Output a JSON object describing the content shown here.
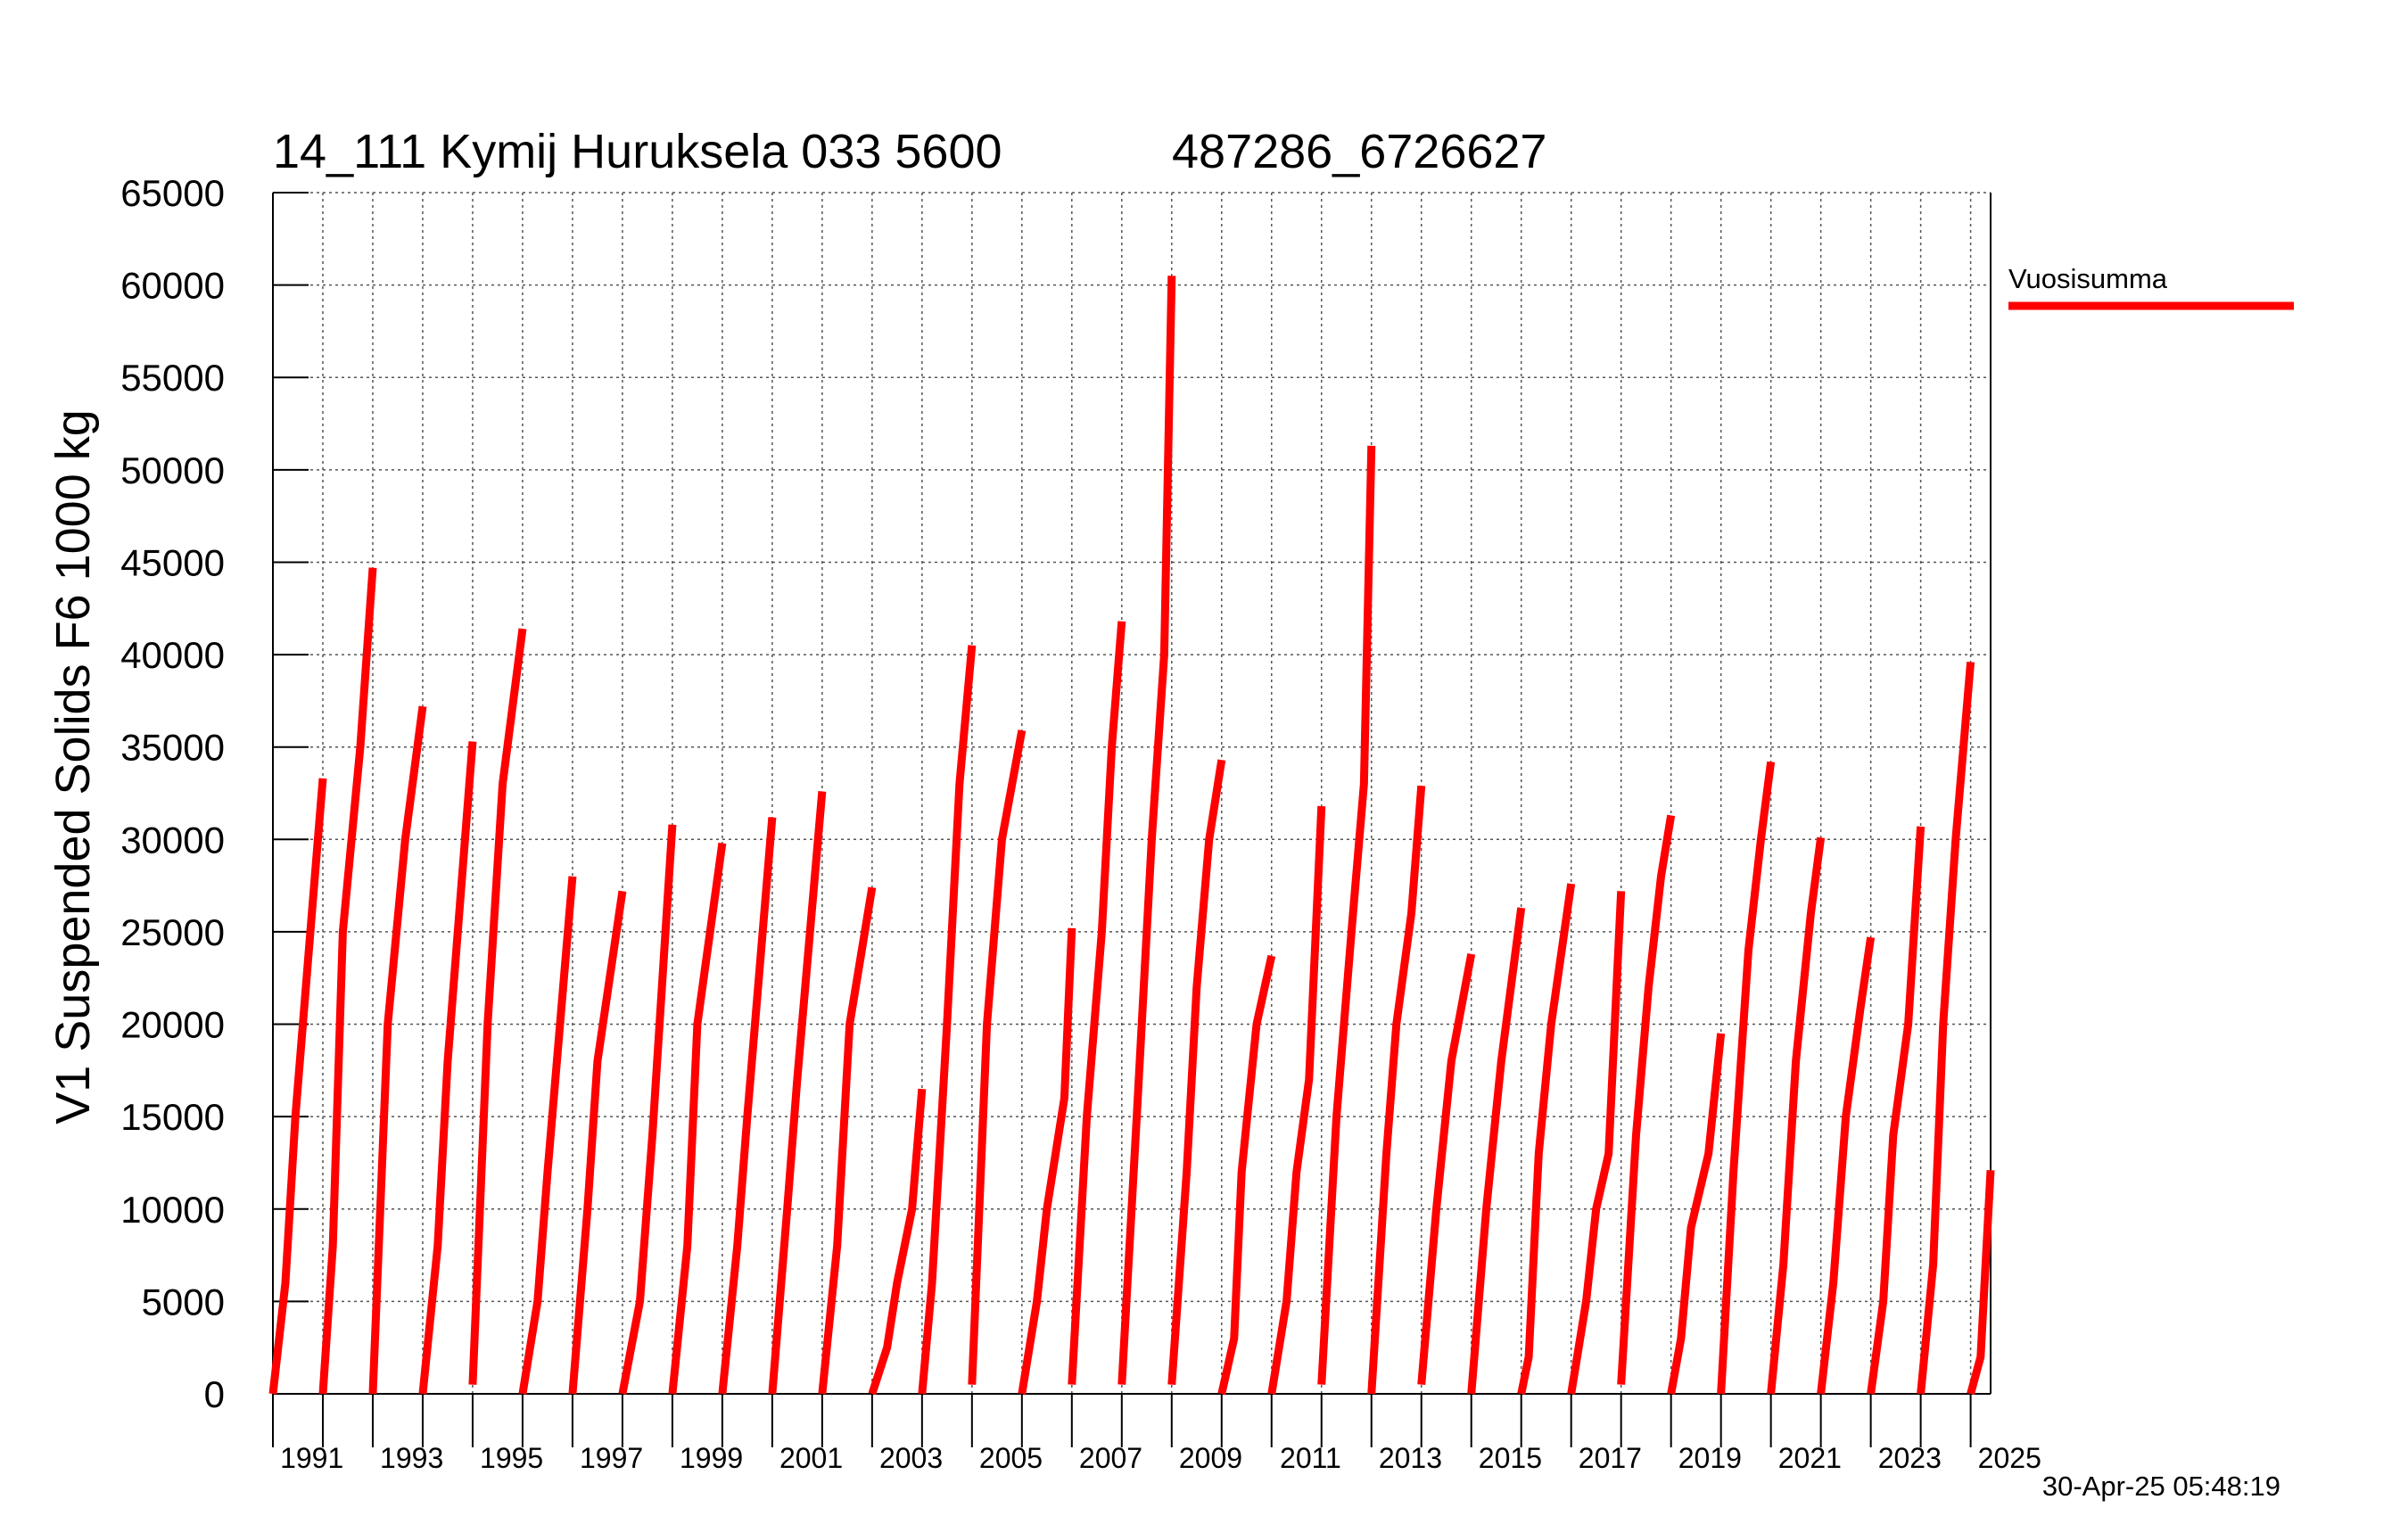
{
  "colors": {
    "series": "#ff0000",
    "grid": "#555555",
    "axis": "#000000"
  },
  "chart_data": {
    "type": "line",
    "title_left": "14_111 Kymij Huruksela 033 5600",
    "title_right": "487286_6726627",
    "ylabel": "V1 Suspended Solids F6 1000 kg",
    "xlabel": "",
    "ylim": [
      0,
      65000
    ],
    "xlim": [
      1990.0,
      2024.4
    ],
    "y_ticks": [
      "0",
      "5000",
      "10000",
      "15000",
      "20000",
      "25000",
      "30000",
      "35000",
      "40000",
      "45000",
      "50000",
      "55000",
      "60000",
      "65000"
    ],
    "x_tick_labels": [
      "1991",
      "1993",
      "1995",
      "1997",
      "1999",
      "2001",
      "2003",
      "2005",
      "2007",
      "2009",
      "2011",
      "2013",
      "2015",
      "2017",
      "2019",
      "2021",
      "2023",
      "2025"
    ],
    "grid": true,
    "legend_position": "right",
    "timestamp": "30-Apr-25 05:48:19",
    "series": [
      {
        "name": "Vuosisumma",
        "years": [
          {
            "year": 1990,
            "points": [
              [
                0.0,
                0
              ],
              [
                0.25,
                6000
              ],
              [
                0.45,
                15000
              ],
              [
                0.75,
                25000
              ],
              [
                1.0,
                33300
              ]
            ]
          },
          {
            "year": 1991,
            "points": [
              [
                0.0,
                0
              ],
              [
                0.2,
                8000
              ],
              [
                0.4,
                25000
              ],
              [
                0.75,
                35000
              ],
              [
                1.0,
                44700
              ]
            ]
          },
          {
            "year": 1992,
            "points": [
              [
                0.0,
                0
              ],
              [
                0.3,
                20000
              ],
              [
                0.65,
                30000
              ],
              [
                1.0,
                37200
              ]
            ]
          },
          {
            "year": 1993,
            "points": [
              [
                0.0,
                0
              ],
              [
                0.3,
                8000
              ],
              [
                0.5,
                18000
              ],
              [
                1.0,
                35300
              ]
            ]
          },
          {
            "year": 1994,
            "points": [
              [
                0.0,
                500
              ],
              [
                0.3,
                20000
              ],
              [
                0.6,
                33000
              ],
              [
                1.0,
                41400
              ]
            ]
          },
          {
            "year": 1995,
            "points": [
              [
                0.0,
                0
              ],
              [
                0.3,
                5000
              ],
              [
                0.5,
                12000
              ],
              [
                0.75,
                20000
              ],
              [
                1.0,
                28000
              ]
            ]
          },
          {
            "year": 1996,
            "points": [
              [
                0.0,
                0
              ],
              [
                0.3,
                10000
              ],
              [
                0.5,
                18000
              ],
              [
                1.0,
                27200
              ]
            ]
          },
          {
            "year": 1997,
            "points": [
              [
                0.0,
                0
              ],
              [
                0.35,
                5000
              ],
              [
                0.6,
                14000
              ],
              [
                1.0,
                30800
              ]
            ]
          },
          {
            "year": 1998,
            "points": [
              [
                0.0,
                0
              ],
              [
                0.3,
                8000
              ],
              [
                0.5,
                20000
              ],
              [
                1.0,
                29800
              ]
            ]
          },
          {
            "year": 1999,
            "points": [
              [
                0.0,
                0
              ],
              [
                0.3,
                8000
              ],
              [
                0.5,
                15000
              ],
              [
                1.0,
                31200
              ]
            ]
          },
          {
            "year": 2000,
            "points": [
              [
                0.0,
                0
              ],
              [
                0.3,
                10000
              ],
              [
                0.5,
                17000
              ],
              [
                1.0,
                32600
              ]
            ]
          },
          {
            "year": 2001,
            "points": [
              [
                0.0,
                0
              ],
              [
                0.3,
                8000
              ],
              [
                0.55,
                20000
              ],
              [
                1.0,
                27400
              ]
            ]
          },
          {
            "year": 2002,
            "points": [
              [
                0.0,
                0
              ],
              [
                0.3,
                2500
              ],
              [
                0.5,
                6000
              ],
              [
                0.8,
                10000
              ],
              [
                1.0,
                16500
              ]
            ]
          },
          {
            "year": 2003,
            "points": [
              [
                0.0,
                0
              ],
              [
                0.2,
                6000
              ],
              [
                0.5,
                20000
              ],
              [
                0.75,
                33000
              ],
              [
                1.0,
                40500
              ]
            ]
          },
          {
            "year": 2004,
            "points": [
              [
                0.0,
                500
              ],
              [
                0.3,
                20000
              ],
              [
                0.6,
                30000
              ],
              [
                1.0,
                35900
              ]
            ]
          },
          {
            "year": 2005,
            "points": [
              [
                0.0,
                0
              ],
              [
                0.3,
                5000
              ],
              [
                0.5,
                10000
              ],
              [
                0.85,
                16000
              ],
              [
                1.0,
                25200
              ]
            ]
          },
          {
            "year": 2006,
            "points": [
              [
                0.0,
                500
              ],
              [
                0.3,
                15000
              ],
              [
                0.6,
                25000
              ],
              [
                0.8,
                35000
              ],
              [
                1.0,
                41800
              ]
            ]
          },
          {
            "year": 2007,
            "points": [
              [
                0.0,
                500
              ],
              [
                0.3,
                15000
              ],
              [
                0.6,
                30000
              ],
              [
                0.85,
                40000
              ],
              [
                1.0,
                60500
              ]
            ]
          },
          {
            "year": 2008,
            "points": [
              [
                0.0,
                500
              ],
              [
                0.3,
                12000
              ],
              [
                0.5,
                22000
              ],
              [
                0.75,
                30000
              ],
              [
                1.0,
                34300
              ]
            ]
          },
          {
            "year": 2009,
            "points": [
              [
                0.0,
                0
              ],
              [
                0.25,
                3000
              ],
              [
                0.4,
                12000
              ],
              [
                0.7,
                20000
              ],
              [
                1.0,
                23700
              ]
            ]
          },
          {
            "year": 2010,
            "points": [
              [
                0.0,
                0
              ],
              [
                0.3,
                5000
              ],
              [
                0.5,
                12000
              ],
              [
                0.75,
                17000
              ],
              [
                1.0,
                31800
              ]
            ]
          },
          {
            "year": 2011,
            "points": [
              [
                0.0,
                500
              ],
              [
                0.3,
                15000
              ],
              [
                0.6,
                25000
              ],
              [
                0.85,
                33000
              ],
              [
                1.0,
                51300
              ]
            ]
          },
          {
            "year": 2012,
            "points": [
              [
                0.0,
                0
              ],
              [
                0.3,
                13000
              ],
              [
                0.5,
                20000
              ],
              [
                0.8,
                26000
              ],
              [
                1.0,
                32900
              ]
            ]
          },
          {
            "year": 2013,
            "points": [
              [
                0.0,
                500
              ],
              [
                0.3,
                10000
              ],
              [
                0.6,
                18000
              ],
              [
                1.0,
                23800
              ]
            ]
          },
          {
            "year": 2014,
            "points": [
              [
                0.0,
                0
              ],
              [
                0.3,
                10000
              ],
              [
                0.6,
                18000
              ],
              [
                1.0,
                26300
              ]
            ]
          },
          {
            "year": 2015,
            "points": [
              [
                0.0,
                0
              ],
              [
                0.15,
                2000
              ],
              [
                0.35,
                13000
              ],
              [
                0.6,
                20000
              ],
              [
                1.0,
                27600
              ]
            ]
          },
          {
            "year": 2016,
            "points": [
              [
                0.0,
                0
              ],
              [
                0.3,
                5000
              ],
              [
                0.5,
                10000
              ],
              [
                0.75,
                13000
              ],
              [
                1.0,
                27200
              ]
            ]
          },
          {
            "year": 2017,
            "points": [
              [
                0.0,
                500
              ],
              [
                0.3,
                14000
              ],
              [
                0.55,
                22000
              ],
              [
                0.8,
                28000
              ],
              [
                1.0,
                31300
              ]
            ]
          },
          {
            "year": 2018,
            "points": [
              [
                0.0,
                0
              ],
              [
                0.2,
                3000
              ],
              [
                0.4,
                9000
              ],
              [
                0.75,
                13000
              ],
              [
                1.0,
                19500
              ]
            ]
          },
          {
            "year": 2019,
            "points": [
              [
                0.0,
                0
              ],
              [
                0.25,
                12000
              ],
              [
                0.55,
                24000
              ],
              [
                0.8,
                30000
              ],
              [
                1.0,
                34200
              ]
            ]
          },
          {
            "year": 2020,
            "points": [
              [
                0.0,
                0
              ],
              [
                0.25,
                7000
              ],
              [
                0.5,
                18000
              ],
              [
                0.8,
                26000
              ],
              [
                1.0,
                30100
              ]
            ]
          },
          {
            "year": 2021,
            "points": [
              [
                0.0,
                0
              ],
              [
                0.25,
                6000
              ],
              [
                0.5,
                15000
              ],
              [
                0.8,
                21000
              ],
              [
                1.0,
                24700
              ]
            ]
          },
          {
            "year": 2022,
            "points": [
              [
                0.0,
                0
              ],
              [
                0.25,
                5000
              ],
              [
                0.45,
                14000
              ],
              [
                0.75,
                20000
              ],
              [
                1.0,
                30700
              ]
            ]
          },
          {
            "year": 2023,
            "points": [
              [
                0.0,
                0
              ],
              [
                0.25,
                7000
              ],
              [
                0.45,
                20000
              ],
              [
                0.7,
                30000
              ],
              [
                1.0,
                39600
              ]
            ]
          },
          {
            "year": 2024,
            "points": [
              [
                0.0,
                0
              ],
              [
                0.2,
                2000
              ],
              [
                0.4,
                12100
              ]
            ]
          }
        ]
      }
    ]
  }
}
